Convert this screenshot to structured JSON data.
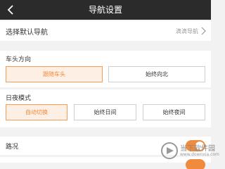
{
  "header": {
    "title": "导航设置",
    "back_icon": "back-arrow-icon"
  },
  "default_nav": {
    "label": "选择默认导航",
    "value": "滴滴导航",
    "chevron_icon": "chevron-right-icon"
  },
  "direction": {
    "title": "车头方向",
    "options": [
      "跟随车头",
      "始终向北"
    ],
    "selected": "跟随车头"
  },
  "day_night": {
    "title": "日夜模式",
    "options": [
      "自动切换",
      "始终日间",
      "始终夜间"
    ],
    "selected": "自动切换"
  },
  "traffic": {
    "label": "路况",
    "enabled": true
  },
  "colors": {
    "accent": "#f08a3c",
    "header_bg": "#2b2b2b"
  },
  "watermark": {
    "text": "当下软件园",
    "url": "www.downxia.com"
  }
}
